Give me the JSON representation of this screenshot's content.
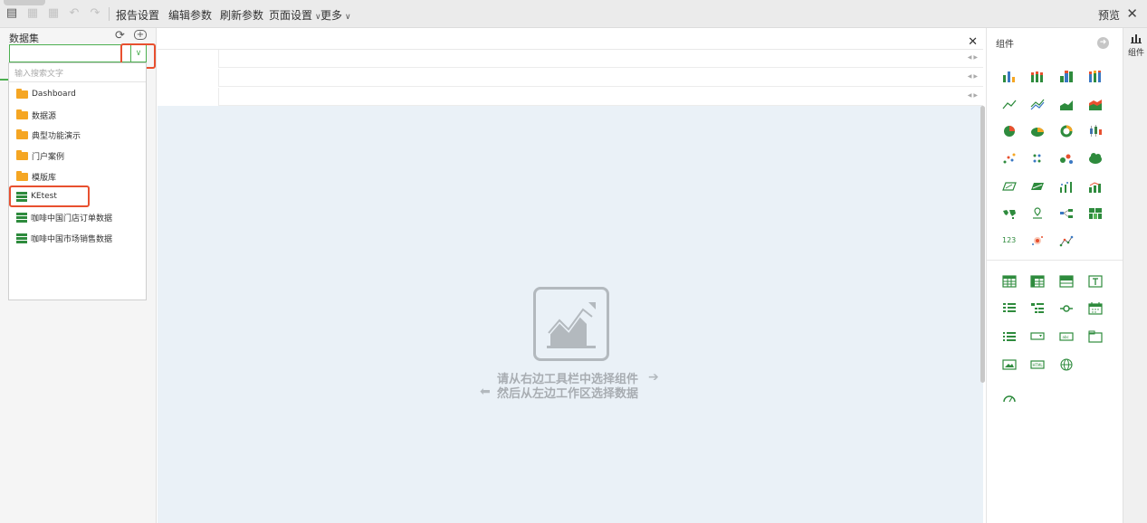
{
  "toolbar": {
    "items": [
      "报告设置",
      "编辑参数",
      "刷新参数",
      "页面设置",
      "更多"
    ],
    "preview": "预览"
  },
  "dataset_panel": {
    "title": "数据集",
    "search_placeholder": "输入搜索文字",
    "items": [
      {
        "label": "Dashboard",
        "type": "folder"
      },
      {
        "label": "数据源",
        "type": "folder"
      },
      {
        "label": "典型功能演示",
        "type": "folder"
      },
      {
        "label": "门户案例",
        "type": "folder"
      },
      {
        "label": "模版库",
        "type": "folder"
      },
      {
        "label": "KEtest",
        "type": "dataset"
      },
      {
        "label": "咖啡中国门店订单数据",
        "type": "dataset"
      },
      {
        "label": "咖啡中国市场销售数据",
        "type": "dataset"
      }
    ]
  },
  "canvas": {
    "hint_line1": "请从右边工具栏中选择组件",
    "hint_line2": "然后从左边工作区选择数据"
  },
  "components_panel": {
    "title": "组件",
    "side_tab": "组件",
    "number_icon_text": "123",
    "chart_icons": [
      "bar-chart-icon",
      "stacked-bar-icon",
      "grouped-bar-icon",
      "stacked-bar-2-icon",
      "line-chart-icon",
      "multi-line-icon",
      "area-chart-icon",
      "stacked-area-icon",
      "pie-chart-icon",
      "pie-3d-icon",
      "donut-chart-icon",
      "boxplot-icon",
      "scatter-icon",
      "dot-matrix-icon",
      "bubble-icon",
      "word-cloud-icon",
      "parallelogram-icon",
      "map-3d-icon",
      "bar-dot-icon",
      "bar-line-icon",
      "world-map-icon",
      "map-pin-icon",
      "flow-icon",
      "heatmap-grid-icon",
      "kpi-number-icon",
      "heat-blob-icon",
      "path-icon"
    ],
    "widget_icons": [
      "table-icon",
      "pivot-table-icon",
      "crosstab-icon",
      "text-icon",
      "list-filter-icon",
      "tree-filter-icon",
      "slider-icon",
      "calendar-icon",
      "list-icon",
      "dropdown-icon",
      "input-box-icon",
      "tab-icon",
      "image-icon",
      "html-icon",
      "web-icon",
      "gauge-icon"
    ]
  },
  "colors": {
    "accent_green": "#2e8b3d",
    "highlight_red": "#e8502f",
    "folder_orange": "#f5a623",
    "canvas_bg": "#eaf1f7"
  }
}
